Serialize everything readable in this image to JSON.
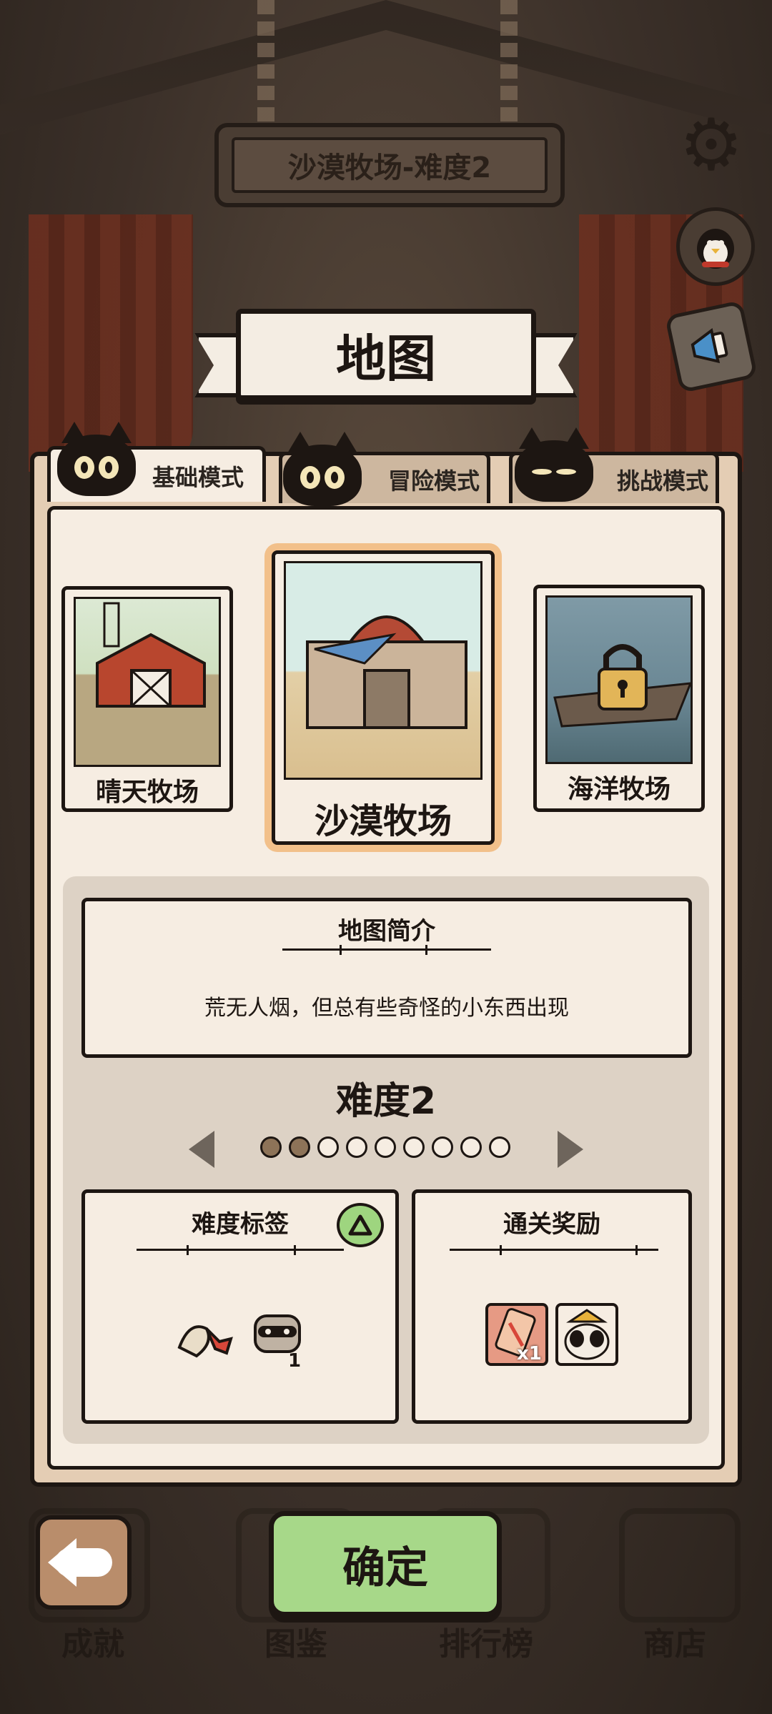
{
  "header": {
    "stage_title": "沙漠牧场-难度2",
    "screen_title": "地图"
  },
  "side_buttons": {
    "settings_icon": "gear-icon",
    "avatar_icon": "penguin-avatar-icon",
    "announce_icon": "megaphone-icon"
  },
  "tabs": [
    {
      "label": "基础模式",
      "active": true
    },
    {
      "label": "冒险模式",
      "active": false
    },
    {
      "label": "挑战模式",
      "active": false
    }
  ],
  "maps": [
    {
      "label": "晴天牧场",
      "selected": false,
      "locked": false
    },
    {
      "label": "沙漠牧场",
      "selected": true,
      "locked": false
    },
    {
      "label": "海洋牧场",
      "selected": false,
      "locked": true
    }
  ],
  "intro": {
    "title": "地图简介",
    "text": "荒无人烟，但总有些奇怪的小东西出现"
  },
  "difficulty": {
    "label": "难度2",
    "current": 2,
    "total": 9
  },
  "difficulty_tags": {
    "title": "难度标签",
    "items": [
      {
        "icon": "seed-bag-icon"
      },
      {
        "icon": "raccoon-icon",
        "count": "1"
      }
    ]
  },
  "rewards": {
    "title": "通关奖励",
    "items": [
      {
        "icon": "ticket-icon",
        "count": "x1"
      },
      {
        "icon": "cat-skin-icon"
      }
    ]
  },
  "bottom_nav": {
    "confirm_label": "确定",
    "items": [
      "成就",
      "图鉴",
      "排行榜",
      "商店"
    ]
  },
  "colors": {
    "confirm_green": "#a7d889",
    "panel_tan": "#e4cdb4",
    "paper": "#f6ede2",
    "selected_glow": "#f2c08a"
  }
}
